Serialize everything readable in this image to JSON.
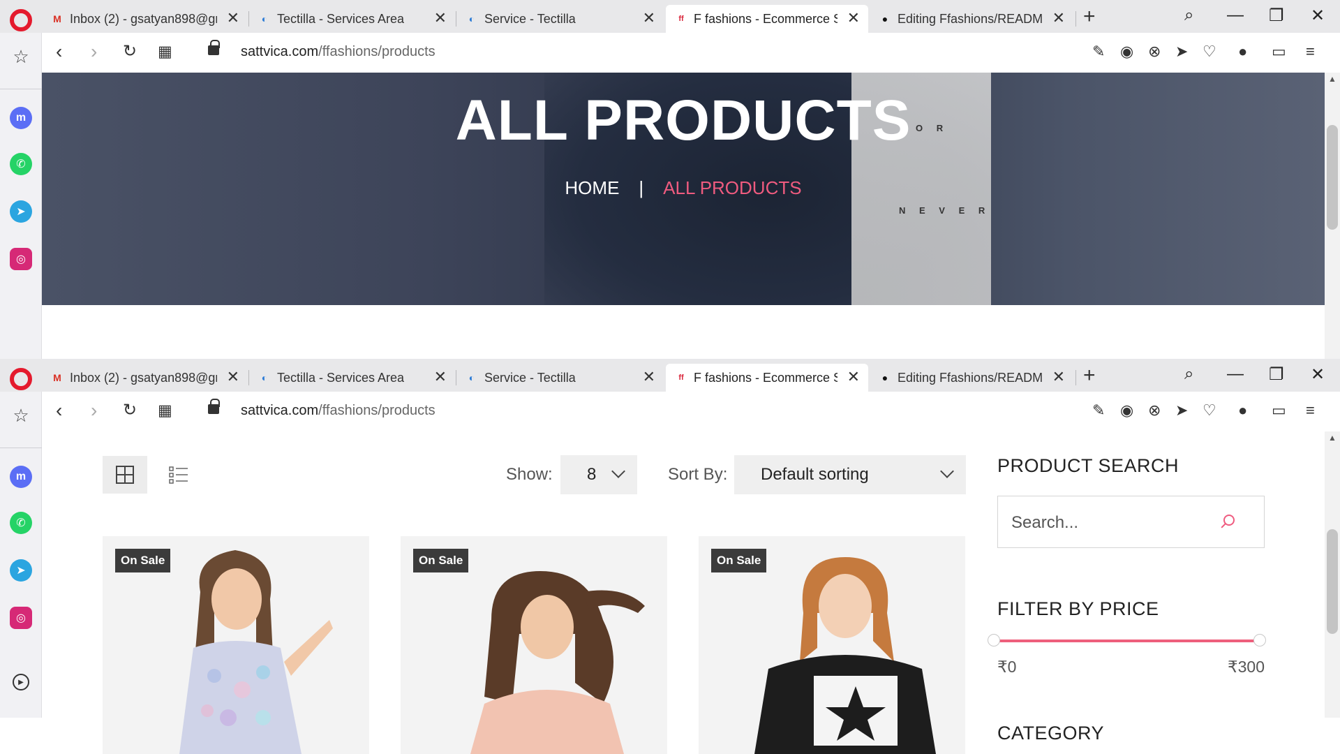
{
  "browser": {
    "tabs": [
      {
        "title": "Inbox (2) - gsatyan898@gn",
        "favicon": "gmail-icon",
        "active": false
      },
      {
        "title": "Tectilla - Services Area",
        "favicon": "tectilla-icon",
        "active": false
      },
      {
        "title": "Service - Tectilla",
        "favicon": "tectilla-icon",
        "active": false
      },
      {
        "title": "F fashions - Ecommerce Sy:",
        "favicon": "ffashions-icon",
        "active": true
      },
      {
        "title": "Editing Ffashions/README.",
        "favicon": "github-icon",
        "active": false
      }
    ],
    "url_host": "sattvica.com",
    "url_path": "/ffashions/products",
    "sidebar_icons": [
      "bookmark-star-icon",
      "messenger-icon",
      "whatsapp-icon",
      "telegram-icon",
      "instagram-icon",
      "player-icon"
    ]
  },
  "hero": {
    "title": "ALL PRODUCTS",
    "breadcrumb_home": "HOME",
    "breadcrumb_sep": "|",
    "breadcrumb_current": "ALL PRODUCTS",
    "shirt_text_1": "O R",
    "shirt_text_2": "N E V E R"
  },
  "toolbar": {
    "show_label": "Show:",
    "show_value": "8",
    "sort_label": "Sort By:",
    "sort_value": "Default sorting"
  },
  "products": [
    {
      "badge": "On Sale"
    },
    {
      "badge": "On Sale"
    },
    {
      "badge": "On Sale"
    }
  ],
  "sidebar": {
    "search_title": "PRODUCT SEARCH",
    "search_placeholder": "Search...",
    "price_title": "FILTER BY PRICE",
    "price_min": "₹0",
    "price_max": "₹300",
    "category_title": "CATEGORY"
  },
  "colors": {
    "accent": "#ef5b7f",
    "badge": "#3b3b3b",
    "hero": "#3a4256"
  }
}
